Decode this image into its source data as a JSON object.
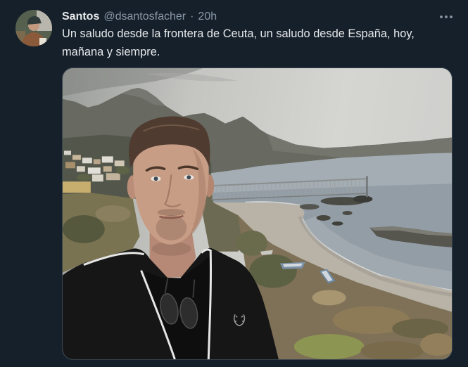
{
  "tweet": {
    "author": {
      "display_name": "Santos",
      "handle": "@dsantosfacher"
    },
    "separator": "·",
    "timestamp": "20h",
    "text": "Un saludo desde la frontera de Ceuta, un saludo desde España, hoy, mañana y siempre."
  },
  "icons": {
    "more": "more-horizontal-icon",
    "avatar": "user-avatar"
  },
  "colors": {
    "background": "#15202b",
    "text_primary": "#e7e9ea",
    "text_secondary": "#8b98a5",
    "border": "#38444d"
  }
}
